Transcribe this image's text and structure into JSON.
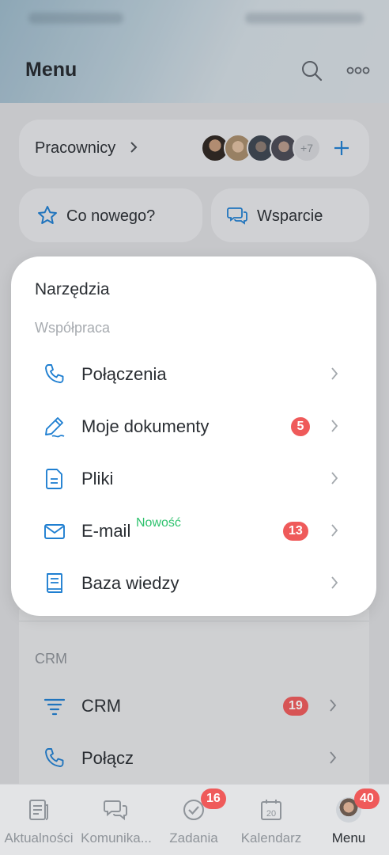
{
  "header": {
    "title": "Menu"
  },
  "workers": {
    "label": "Pracownicy",
    "extra_count": "+7"
  },
  "quick": {
    "news_label": "Co nowego?",
    "support_label": "Wsparcie"
  },
  "tools": {
    "heading": "Narzędzia",
    "section": "Współpraca",
    "items": [
      {
        "label": "Połączenia",
        "badge": "",
        "tag": ""
      },
      {
        "label": "Moje dokumenty",
        "badge": "5",
        "tag": ""
      },
      {
        "label": "Pliki",
        "badge": "",
        "tag": ""
      },
      {
        "label": "E-mail",
        "badge": "13",
        "tag": "Nowość"
      },
      {
        "label": "Baza wiedzy",
        "badge": "",
        "tag": ""
      }
    ]
  },
  "crm": {
    "section": "CRM",
    "items": [
      {
        "label": "CRM",
        "badge": "19"
      },
      {
        "label": "Połącz",
        "badge": ""
      }
    ]
  },
  "tabbar": {
    "items": [
      {
        "label": "Aktualności",
        "badge": ""
      },
      {
        "label": "Komunika...",
        "badge": ""
      },
      {
        "label": "Zadania",
        "badge": "16"
      },
      {
        "label": "Kalendarz",
        "badge": "",
        "icon_text": "20"
      },
      {
        "label": "Menu",
        "badge": "40"
      }
    ]
  },
  "colors": {
    "accent": "#1f7fd1",
    "badge": "#ef5a5a",
    "new": "#2fc26e"
  }
}
